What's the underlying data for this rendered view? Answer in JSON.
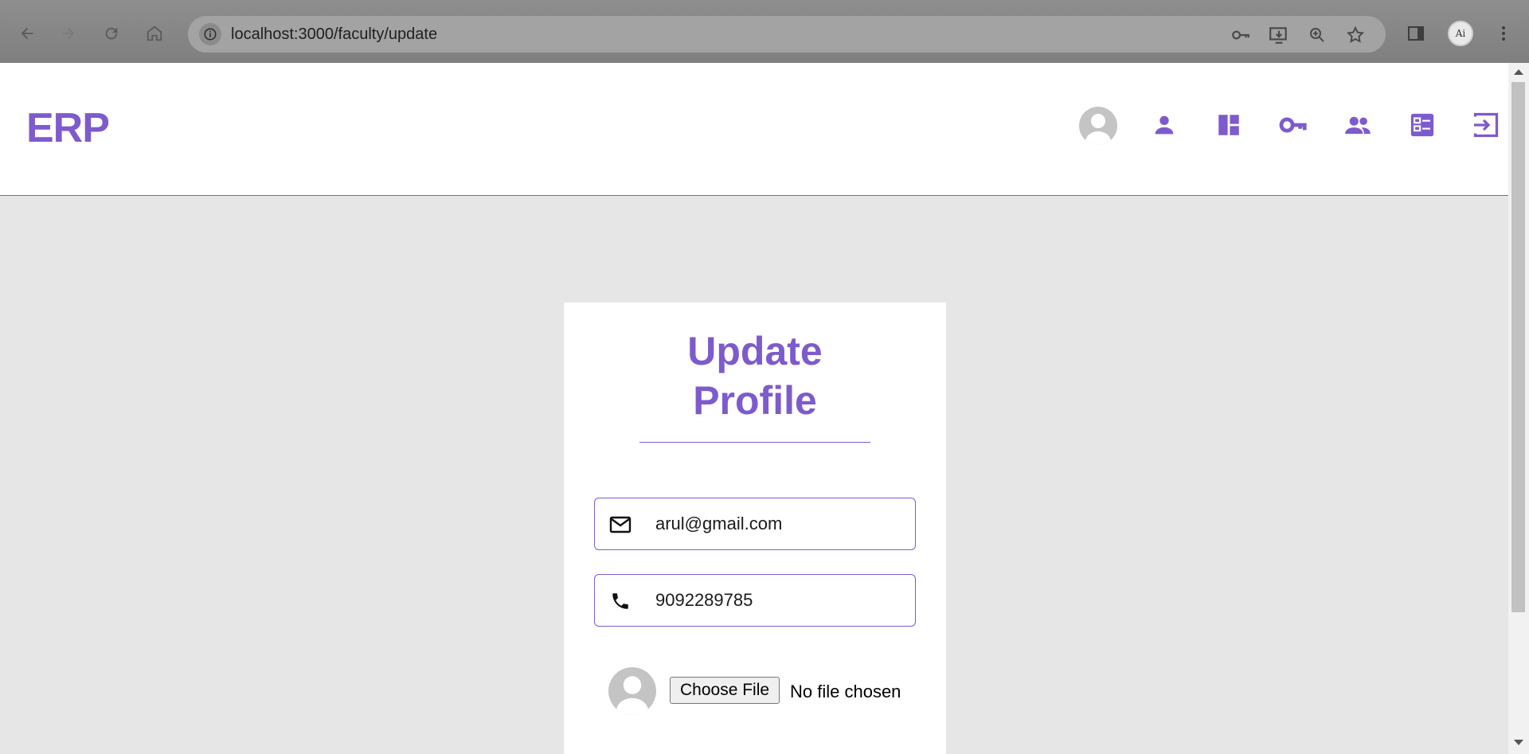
{
  "browser": {
    "url": "localhost:3000/faculty/update",
    "profile_initials": "Ai"
  },
  "header": {
    "logo": "ERP",
    "icons": [
      "avatar",
      "person-icon",
      "dashboard-icon",
      "key-icon",
      "group-icon",
      "list-icon",
      "logout-icon"
    ]
  },
  "form": {
    "title_line1": "Update",
    "title_line2": "Profile",
    "email_value": "arul@gmail.com",
    "phone_value": "9092289785",
    "choose_file_label": "Choose File",
    "no_file_text": "No file chosen"
  },
  "colors": {
    "accent": "#7e5bcc",
    "background": "#e6e6e6"
  }
}
